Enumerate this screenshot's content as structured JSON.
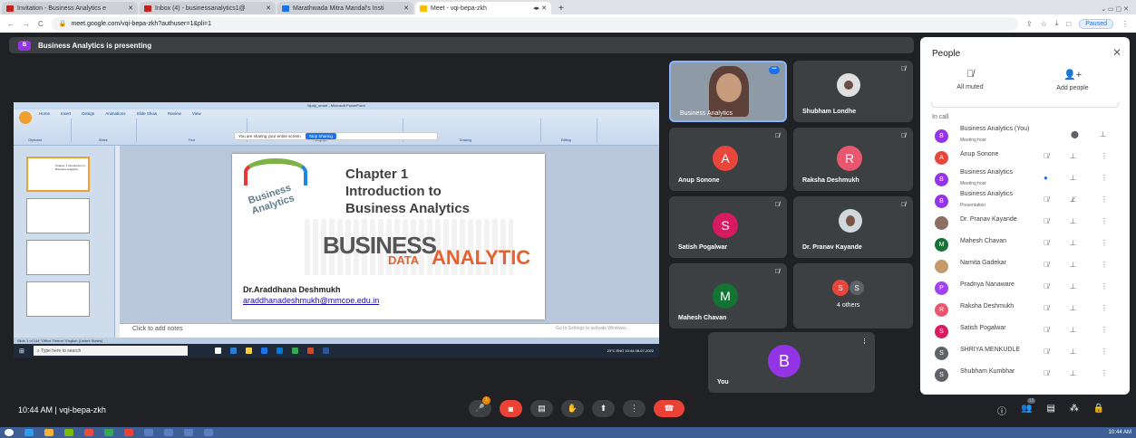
{
  "browser": {
    "tabs": [
      {
        "label": "Invitation - Business Analytics e",
        "color": "#c5221f"
      },
      {
        "label": "Inbox (4) - businessanalytics1@",
        "color": "#c5221f"
      },
      {
        "label": "Marathwada Mitra Mandal's Insti",
        "color": "#1a73e8"
      },
      {
        "label": "Meet - vqi-bepa-zkh",
        "color": "#fbbc04",
        "active": true
      }
    ],
    "url": "meet.google.com/vqi-bepa-zkh?authuser=1&pli=1",
    "paused_label": "Paused"
  },
  "presenting_banner": {
    "badge": "B",
    "text": "Business Analytics is presenting"
  },
  "shared_screen": {
    "window_title": "tfjudy_smart - Microsoft PowerPoint",
    "ribbon_tabs": [
      "Home",
      "Insert",
      "Design",
      "Animations",
      "Slide Show",
      "Review",
      "View"
    ],
    "ribbon_groups": [
      "Clipboard",
      "Slides",
      "Font",
      "Paragraph",
      "Drawing",
      "Editing"
    ],
    "sharing_text": "You are sharing your entire screen.",
    "stop_sharing": "Stop Sharing",
    "thumb_text": "Chapter 1 Introduction to Business Analytics",
    "slide": {
      "chapter": "Chapter 1",
      "title_line1": "Introduction to",
      "title_line2": "Business Analytics",
      "word_big1": "BUSINESS",
      "word_big2": "DATA",
      "word_big3": "ANALYTIC",
      "author": "Dr.Araddhana Deshmukh",
      "email": "araddhanadeshmukh@mmcoe.edu.in"
    },
    "notes": "Click to add notes",
    "activate": "Go to Settings to activate Windows.",
    "status": "Slide 1 of 144    \"Office Theme\"    English (United States)",
    "search": "Type here to search",
    "tray": "23°C  ENG  10:44  08-07-2022"
  },
  "tiles": {
    "business_analytics": "Business Analytics",
    "shubham": "Shubham Londhe",
    "anup": {
      "initial": "A",
      "name": "Anup Sonone",
      "color": "#e8453c"
    },
    "raksha": {
      "initial": "R",
      "name": "Raksha Deshmukh",
      "color": "#e8576f"
    },
    "satish": {
      "initial": "S",
      "name": "Satish Pogalwar",
      "color": "#d81b60"
    },
    "pranav": "Dr. Pranav Kayande",
    "mahesh": {
      "initial": "M",
      "name": "Mahesh Chavan",
      "color": "#137333"
    },
    "others": {
      "initials": [
        "S",
        "S"
      ],
      "label": "4 others",
      "color": "#e8453c"
    },
    "you": {
      "initial": "B",
      "name": "You",
      "color": "#9334e6"
    }
  },
  "people_panel": {
    "title": "People",
    "all_muted": "All muted",
    "add_people": "Add people",
    "in_call": "In call",
    "participants": [
      {
        "initial": "B",
        "name": "Business Analytics (You)",
        "sub": "Meeting host",
        "color": "#9334e6"
      },
      {
        "initial": "A",
        "name": "Anup Sonone",
        "sub": "",
        "color": "#e8453c"
      },
      {
        "initial": "B",
        "name": "Business Analytics",
        "sub": "Meeting host",
        "color": "#9334e6"
      },
      {
        "initial": "B",
        "name": "Business Analytics",
        "sub": "Presentation",
        "color": "#9334e6"
      },
      {
        "initial": "",
        "name": "Dr. Pranav Kayande",
        "sub": "",
        "color": "#8d6e63"
      },
      {
        "initial": "M",
        "name": "Mahesh Chavan",
        "sub": "",
        "color": "#137333"
      },
      {
        "initial": "",
        "name": "Namita Gadekar",
        "sub": "",
        "color": "#c49a6c"
      },
      {
        "initial": "P",
        "name": "Pradnya Nanaware",
        "sub": "",
        "color": "#a142f4"
      },
      {
        "initial": "R",
        "name": "Raksha Deshmukh",
        "sub": "",
        "color": "#e8576f"
      },
      {
        "initial": "S",
        "name": "Satish Pogalwar",
        "sub": "",
        "color": "#d81b60"
      },
      {
        "initial": "S",
        "name": "SHRIYA MENKUDLE",
        "sub": "",
        "color": "#5f6368"
      },
      {
        "initial": "S",
        "name": "Shubham Kumbhar",
        "sub": "",
        "color": "#5f6368"
      }
    ]
  },
  "bottom_bar": {
    "time_meeting": "10:44 AM  |  vqi-bepa-zkh",
    "participant_count": "13",
    "hand_badge": "2"
  },
  "os_tray": "10:44 AM"
}
